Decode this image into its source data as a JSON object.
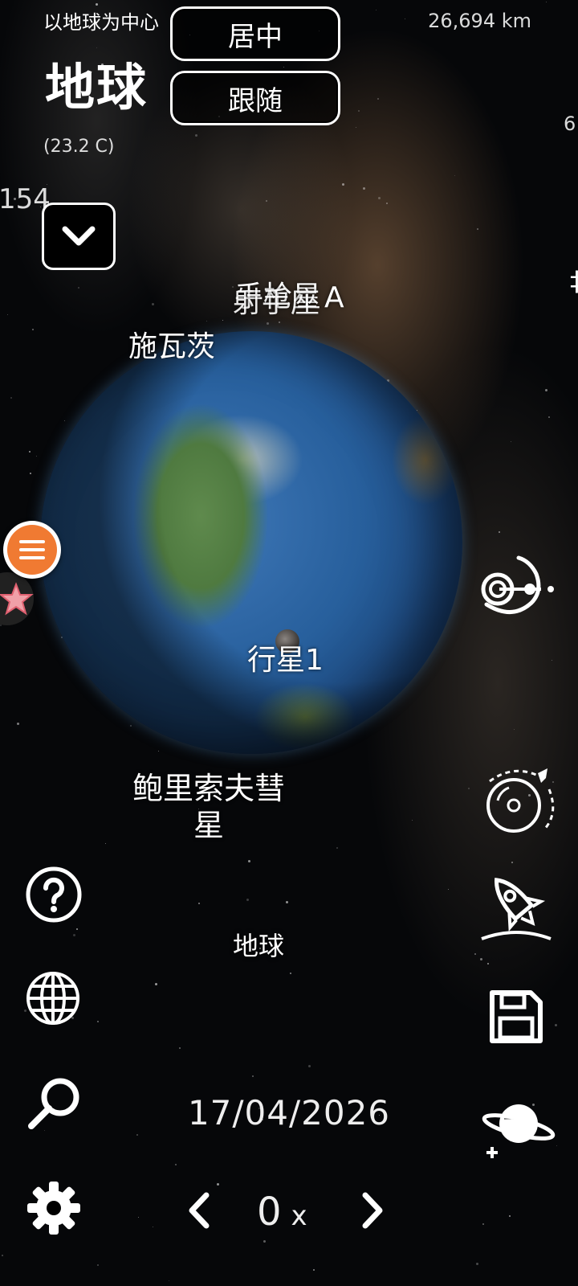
{
  "header": {
    "center_mode_label": "以地球为中心",
    "planet_name": "地球",
    "temperature": "(23.2 C)",
    "distance": "26,694 km",
    "center_button": "居中",
    "follow_button": "跟随",
    "edge_left_value": "154",
    "edge_right_value": "6"
  },
  "space_labels": {
    "overlap_a": "射手座",
    "overlap_b": "手枪星",
    "overlap_suffix": "A",
    "partial_label": "施瓦茨",
    "moon_label": "行星1",
    "comet_label": "鲍里索夫彗星",
    "bottom_planet_label": "地球"
  },
  "footer": {
    "date": "17/04/2026",
    "speed_value": "0",
    "speed_unit": "x"
  },
  "icons": {
    "left": [
      "help-icon",
      "globe-icon",
      "search-icon",
      "settings-icon"
    ],
    "right": [
      "orbit-icon",
      "satellite-orbit-icon",
      "rocket-launch-icon",
      "save-icon",
      "add-planet-icon"
    ],
    "menu": "menu-icon",
    "dropdown": "chevron-down-icon"
  },
  "colors": {
    "menu_fab": "#f07a32",
    "background": "#050608"
  }
}
